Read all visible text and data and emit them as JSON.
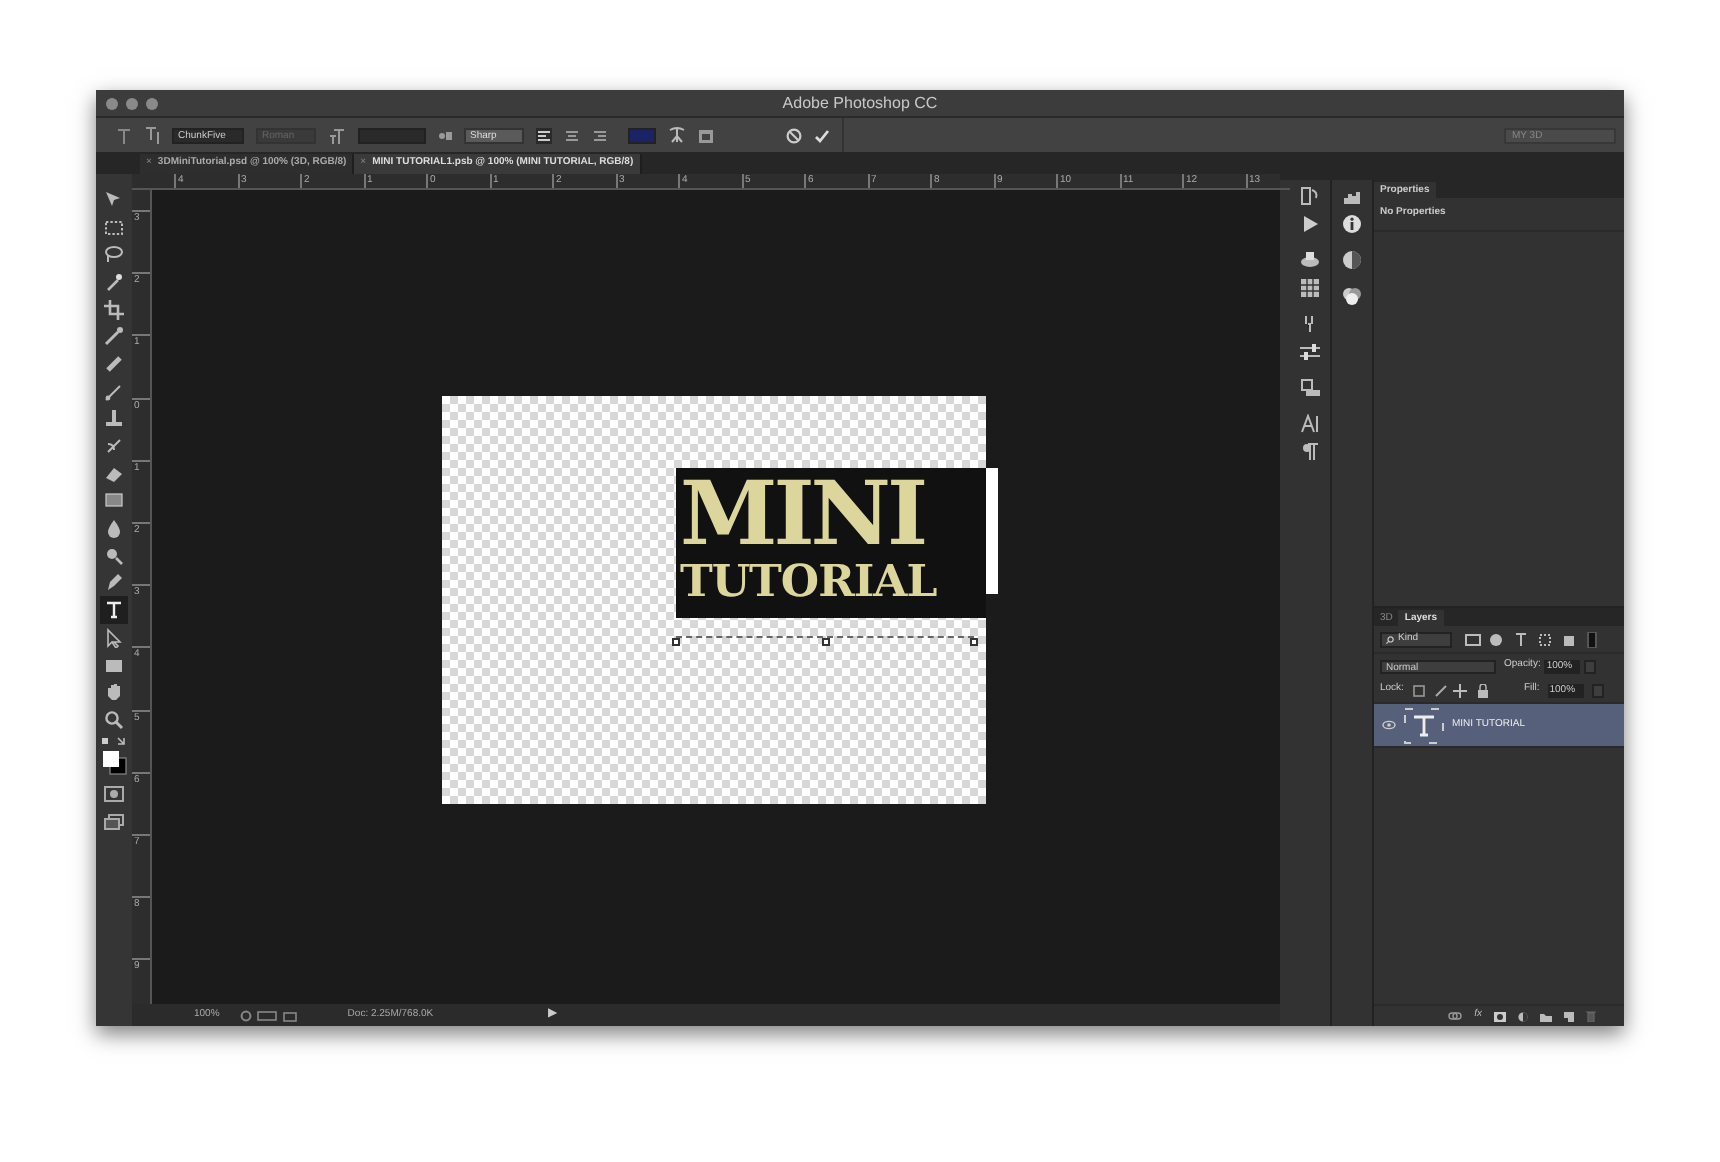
{
  "window": {
    "title": "Adobe Photoshop CC"
  },
  "options_bar": {
    "font_family": "ChunkFive",
    "font_style": "Roman",
    "antialias": "Sharp",
    "color_swatch": {
      "color": "#1c2266"
    },
    "workspace": "MY 3D"
  },
  "tabs": [
    {
      "label": "3DMiniTutorial.psd @ 100% (3D, RGB/8)",
      "close": "×",
      "selected": false
    },
    {
      "label": "MINI TUTORIAL1.psb @ 100% (MINI TUTORIAL, RGB/8)",
      "close": "×",
      "selected": true
    }
  ],
  "ruler_h": [
    "4",
    "3",
    "2",
    "1",
    "0",
    "1",
    "2",
    "3",
    "4",
    "5",
    "6",
    "7",
    "8",
    "9",
    "10",
    "11",
    "12",
    "13"
  ],
  "ruler_v": [
    "3",
    "2",
    "1",
    "0",
    "1",
    "2",
    "3",
    "4",
    "5",
    "6",
    "7",
    "8",
    "9"
  ],
  "tools": [
    {
      "kind": "move",
      "selected": false
    },
    {
      "kind": "marquee",
      "selected": false
    },
    {
      "kind": "lasso",
      "selected": false
    },
    {
      "kind": "wand",
      "selected": false
    },
    {
      "kind": "crop",
      "selected": false
    },
    {
      "kind": "eyedropper",
      "selected": false
    },
    {
      "kind": "bandage",
      "selected": false
    },
    {
      "kind": "brush",
      "selected": false
    },
    {
      "kind": "stamp",
      "selected": false
    },
    {
      "kind": "history",
      "selected": false
    },
    {
      "kind": "eraser",
      "selected": false
    },
    {
      "kind": "gradient",
      "selected": false
    },
    {
      "kind": "drop",
      "selected": false
    },
    {
      "kind": "dodge",
      "selected": false
    },
    {
      "kind": "pen",
      "selected": false
    },
    {
      "kind": "type",
      "selected": true
    },
    {
      "kind": "arrow",
      "selected": false
    },
    {
      "kind": "rect",
      "selected": false
    },
    {
      "kind": "hand",
      "selected": false
    },
    {
      "kind": "zoom",
      "selected": false
    }
  ],
  "document": {
    "line_1": "MINI",
    "line_2": "TUTORIAL"
  },
  "status_bar": {
    "zoom": "100%",
    "doc": "Doc: 2.25M/768.0K",
    "menu": "▶"
  },
  "properties": {
    "tab": "Properties",
    "message": "No Properties"
  },
  "layers_panel": {
    "tabs": [
      {
        "label": "3D",
        "selected": false
      },
      {
        "label": "Layers",
        "selected": true
      }
    ],
    "filter": "Kind",
    "blend_mode": "Normal",
    "opacity_label": "Opacity:",
    "opacity": "100%",
    "lock_label": "Lock:",
    "fill_label": "Fill:",
    "fill": "100%",
    "layers": [
      {
        "name": "MINI TUTORIAL",
        "visible": true,
        "selected": true
      }
    ],
    "footer_fx": "fx"
  }
}
